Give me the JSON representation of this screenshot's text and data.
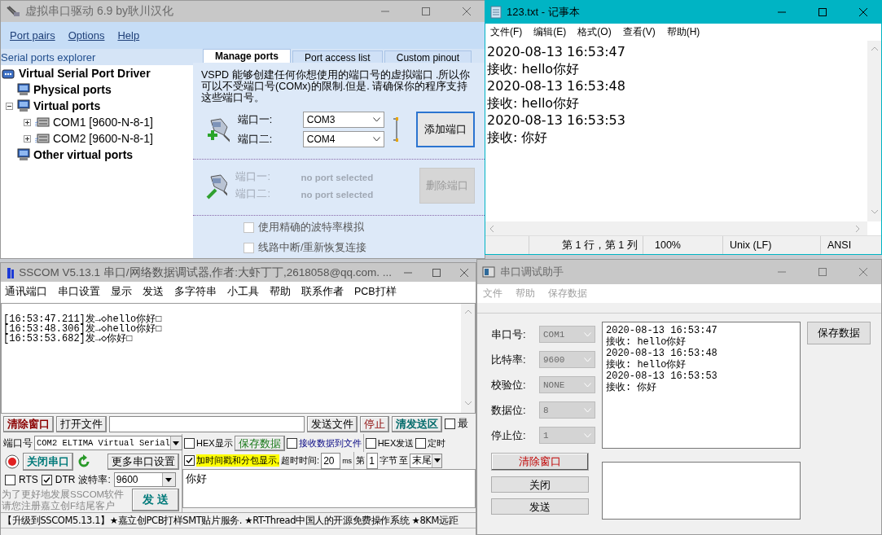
{
  "vspd": {
    "title": "虚拟串口驱动 6.9 by耿川汉化",
    "menu": [
      "Port pairs",
      "Options",
      "Help"
    ],
    "explorer": {
      "title": "Serial ports explorer",
      "tree": [
        {
          "label": "Virtual Serial Port Driver",
          "kind": "root",
          "children": [
            {
              "label": "Physical ports",
              "kind": "group"
            },
            {
              "label": "Virtual ports",
              "kind": "group",
              "expanded": true,
              "children": [
                {
                  "label": "COM1 [9600-N-8-1]",
                  "kind": "port",
                  "expanded": false
                },
                {
                  "label": "COM2 [9600-N-8-1]",
                  "kind": "port",
                  "expanded": false
                }
              ]
            },
            {
              "label": "Other virtual ports",
              "kind": "group"
            }
          ]
        }
      ]
    },
    "tabs": [
      {
        "label": "Manage ports",
        "selected": true
      },
      {
        "label": "Port access list",
        "selected": false
      },
      {
        "label": "Custom pinout",
        "selected": false
      }
    ],
    "description": "VSPD 能够创建任何你想使用的端口号的虚拟端口 .所以你可以不受端口号(COMx)的限制.但是. 请确保你的程序支持这些端口号。",
    "add_pair": {
      "labels": [
        "端口一:",
        "端口二:"
      ],
      "ports": [
        "COM3",
        "COM4"
      ],
      "button": "添加端口",
      "disabled": false
    },
    "delete_pair": {
      "labels": [
        "端口一:",
        "端口二:"
      ],
      "ports": [
        "no port selected",
        "no port selected"
      ],
      "button": "删除端口",
      "disabled": true
    },
    "options": [
      {
        "label": "使用精确的波特率模拟",
        "checked": false,
        "disabled": true
      },
      {
        "label": "线路中断/重新恢复连接",
        "checked": false,
        "disabled": true
      }
    ]
  },
  "notepad": {
    "title": "123.txt - 记事本",
    "menu": [
      "文件(F)",
      "编辑(E)",
      "格式(O)",
      "查看(V)",
      "帮助(H)"
    ],
    "lines": [
      "2020-08-13 16:53:47",
      "接收: hello你好",
      "2020-08-13 16:53:48",
      "接收: hello你好",
      "2020-08-13 16:53:53",
      "接收: 你好"
    ],
    "status": [
      "第 1 行，第 1 列",
      "100%",
      "Unix (LF)",
      "ANSI"
    ]
  },
  "sscom": {
    "title": "SSCOM V5.13.1 串口/网络数据调试器,作者:大虾丁丁,2618058@qq.com. ...",
    "menu": [
      "通讯端口",
      "串口设置",
      "显示",
      "发送",
      "多字符串",
      "小工具",
      "帮助",
      "联系作者",
      "PCB打样"
    ],
    "receive_lines": [
      "[16:53:47.211]发→◇hello你好□",
      "[16:53:48.306]发→◇hello你好□",
      "[16:53:53.682]发→◇你好□"
    ],
    "toolbar": {
      "clear": "清除窗口",
      "open_file": "打开文件",
      "send_file": "发送文件",
      "stop": "停止",
      "clear_send": "清发送区",
      "topmost": {
        "label": "最",
        "checked": false
      }
    },
    "port": {
      "label": "端口号",
      "value": "COM2 ELTIMA Virtual Serial",
      "open": true,
      "close_button": "关闭串口",
      "more_settings": "更多串口设置",
      "rts": {
        "label": "RTS",
        "checked": false
      },
      "dtr": {
        "label": "DTR",
        "checked": true
      },
      "baud_label": "波特率:",
      "baud": "9600"
    },
    "note": [
      "为了更好地发展SSCOM软件",
      "请您注册嘉立创F结尾客户"
    ],
    "send_button": "发 送",
    "options": {
      "hex_display": {
        "label": "HEX显示",
        "checked": false
      },
      "save_data": "保存数据",
      "receive_to_file": {
        "label": "接收数据到文件",
        "checked": false
      },
      "hex_send": {
        "label": "HEX发送",
        "checked": false
      },
      "timed_send": {
        "label": "定时",
        "checked": false
      },
      "timestamp": {
        "label": "加时间戳和分包显示,",
        "checked": true
      },
      "timeout_label": "超时时间:",
      "timeout": "20",
      "timeout_unit": "ms",
      "from_label": "第",
      "from": "1",
      "byte_label": "字节",
      "to_label": "至",
      "to": "末尾"
    },
    "send_text": "你好",
    "ticker": "【升级到SSCOM5.13.1】★嘉立创PCB打样SMT贴片服务. ★RT-Thread中国人的开源免费操作系统 ★8KM远距"
  },
  "assistant": {
    "title": "串口调试助手",
    "menu": [
      {
        "label": "文件",
        "disabled": true
      },
      {
        "label": "帮助",
        "disabled": true
      },
      {
        "label": "保存数据",
        "disabled": true
      }
    ],
    "settings": [
      {
        "label": "串口号:",
        "value": "COM1",
        "disabled": true
      },
      {
        "label": "比特率:",
        "value": "9600",
        "disabled": true
      },
      {
        "label": "校验位:",
        "value": "NONE",
        "disabled": true
      },
      {
        "label": "数据位:",
        "value": "8",
        "disabled": true
      },
      {
        "label": "停止位:",
        "value": "1",
        "disabled": true
      }
    ],
    "buttons": [
      {
        "label": "清除窗口",
        "kind": "danger"
      },
      {
        "label": "关闭",
        "kind": "normal"
      },
      {
        "label": "发送",
        "kind": "normal"
      }
    ],
    "receive_lines": [
      "2020-08-13 16:53:47",
      "接收: hello你好",
      "2020-08-13 16:53:48",
      "接收: hello你好",
      "2020-08-13 16:53:53",
      "接收: 你好"
    ],
    "save_button": "保存数据"
  }
}
